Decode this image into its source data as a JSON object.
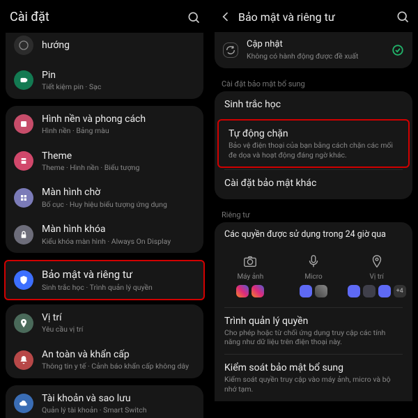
{
  "left": {
    "title": "Cài đặt",
    "items": [
      {
        "icon": "compass",
        "color": "#2c2c2c",
        "title": "hướng",
        "sub": ""
      },
      {
        "icon": "battery",
        "color": "#1aa36f",
        "title": "Pin",
        "sub": "Tiết kiệm pin · Sạc"
      },
      {
        "icon": "wallpaper",
        "color": "#c74d6a",
        "title": "Hình nền và phong cách",
        "sub": "Hình nền · Bảng màu"
      },
      {
        "icon": "theme",
        "color": "#d1486b",
        "title": "Theme",
        "sub": "Theme · Hình nền · Biểu tượng"
      },
      {
        "icon": "home",
        "color": "#7b7bb8",
        "title": "Màn hình chờ",
        "sub": "Bố cục · Huy hiệu biểu tượng ứng dụng"
      },
      {
        "icon": "lock",
        "color": "#6d6d7a",
        "title": "Màn hình khóa",
        "sub": "Kiểu khóa màn hình · Always On Display"
      },
      {
        "icon": "shield",
        "color": "#3d6fff",
        "title": "Bảo mật và riêng tư",
        "sub": "Sinh trắc học · Trình quản lý quyền",
        "hl": true
      },
      {
        "icon": "pin",
        "color": "#4a6a5a",
        "title": "Vị trí",
        "sub": "Yêu cầu vị trí"
      },
      {
        "icon": "bell",
        "color": "#b74848",
        "title": "An toàn và khẩn cấp",
        "sub": "Thông tin y tế · Cảnh báo khẩn cấp không dây"
      },
      {
        "icon": "cloud",
        "color": "#3a6db5",
        "title": "Tài khoản và sao lưu",
        "sub": "Quản lý tài khoản · Smart Switch"
      }
    ]
  },
  "right": {
    "title": "Bảo mật và riêng tư",
    "update": {
      "title": "Cập nhật",
      "sub": "Không có hành động được đề xuất"
    },
    "sec1_label": "Cài đặt bảo mật bổ sung",
    "biometrics": "Sinh trắc học",
    "autoblock": {
      "title": "Tự động chặn",
      "sub": "Bảo vệ điện thoại của bạn bằng cách chặn các mối đe dọa và hoạt động đáng ngờ khác."
    },
    "othersec": "Cài đặt bảo mật khác",
    "privacy_label": "Riêng tư",
    "perm24": "Các quyền được sử dụng trong 24 giờ qua",
    "perms": {
      "cam": "Máy ảnh",
      "mic": "Micro",
      "loc": "Vị trí"
    },
    "more_count": "+4",
    "permmgr": {
      "title": "Trình quản lý quyền",
      "sub": "Cho phép hoặc từ chối ứng dụng truy cập các tính năng như dữ liệu trên điện thoại này."
    },
    "addpriv": {
      "title": "Kiểm soát bảo mật bổ sung",
      "sub": "Kiểm soát quyền truy cập vào máy ảnh, micro và bộ nhớ tạm."
    }
  }
}
